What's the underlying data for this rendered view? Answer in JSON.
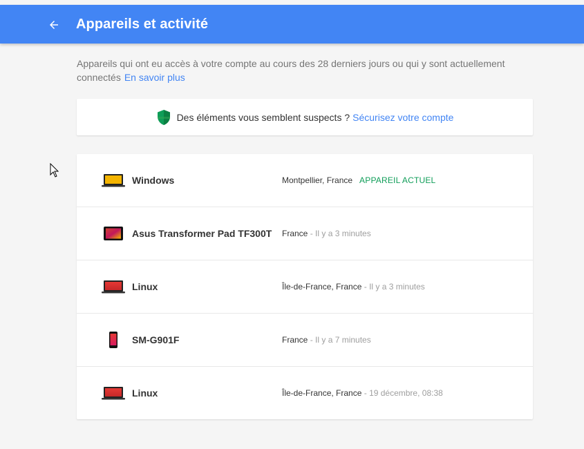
{
  "header": {
    "title": "Appareils et activité",
    "back_icon": "arrow-left-icon"
  },
  "intro": {
    "text": "Appareils qui ont eu accès à votre compte au cours des 28 derniers jours ou qui y sont actuellement connectés",
    "link": "En savoir plus"
  },
  "alert": {
    "icon": "shield-icon",
    "text": "Des éléments vous semblent suspects ?",
    "link": "Sécurisez votre compte"
  },
  "devices": [
    {
      "name": "Windows",
      "icon": "laptop-icon",
      "location": "Montpellier, France",
      "sep": "",
      "time": "",
      "current": "APPAREIL ACTUEL"
    },
    {
      "name": "Asus Transformer Pad TF300T",
      "icon": "tablet-icon",
      "location": "France",
      "sep": " - ",
      "time": "Il y a 3 minutes",
      "current": ""
    },
    {
      "name": "Linux",
      "icon": "laptop-icon",
      "location": "Île-de-France, France",
      "sep": " - ",
      "time": "Il y a 3 minutes",
      "current": ""
    },
    {
      "name": "SM-G901F",
      "icon": "phone-icon",
      "location": "France",
      "sep": " - ",
      "time": "Il y a 7 minutes",
      "current": ""
    },
    {
      "name": "Linux",
      "icon": "laptop-icon",
      "location": "Île-de-France, France",
      "sep": " - ",
      "time": "19 décembre, 08:38",
      "current": ""
    }
  ],
  "colors": {
    "appbar": "#4285f4",
    "link": "#4285f4",
    "current": "#0f9d58"
  }
}
